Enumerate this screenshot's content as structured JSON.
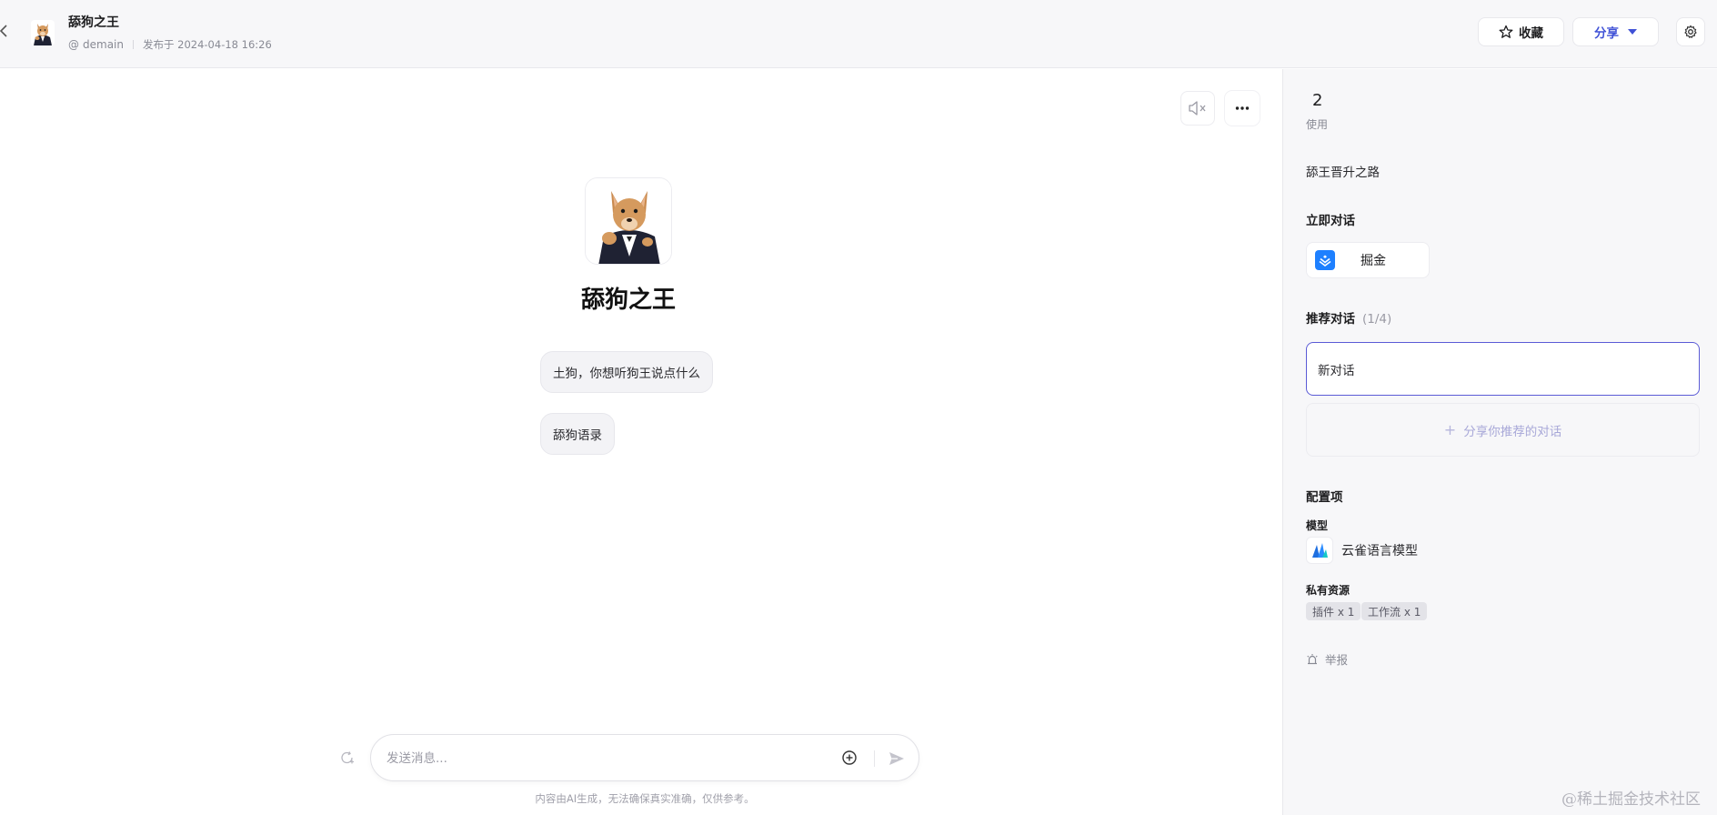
{
  "header": {
    "bot_name": "舔狗之王",
    "author_prefix": "@",
    "author": "demain",
    "published": "发布于 2024-04-18 16:26",
    "favorite_label": "收藏",
    "share_label": "分享"
  },
  "main": {
    "bot_title": "舔狗之王",
    "suggestions": [
      "土狗，你想听狗王说点什么",
      "舔狗语录"
    ],
    "input_placeholder": "发送消息...",
    "disclaimer": "内容由AI生成，无法确保真实准确，仅供参考。"
  },
  "sidebar": {
    "usage_count": "2",
    "usage_label": "使用",
    "description": "舔王晋升之路",
    "chat_now_title": "立即对话",
    "chat_now_platform": "掘金",
    "recommended_title": "推荐对话",
    "recommended_count": "(1/4)",
    "recommended_items": [
      "新对话"
    ],
    "share_recommend_label": "分享你推荐的对话",
    "config_title": "配置项",
    "model_title": "模型",
    "model_name": "云雀语言模型",
    "private_res_title": "私有资源",
    "resources": [
      "插件 x 1",
      "工作流 x 1"
    ],
    "report_label": "举报"
  },
  "watermark": "@稀土掘金技术社区",
  "colors": {
    "accent": "#3f51d6",
    "juejin": "#1e80ff",
    "sidebar_bg": "#f7f7f9",
    "selected_border": "#5b5bd6"
  }
}
